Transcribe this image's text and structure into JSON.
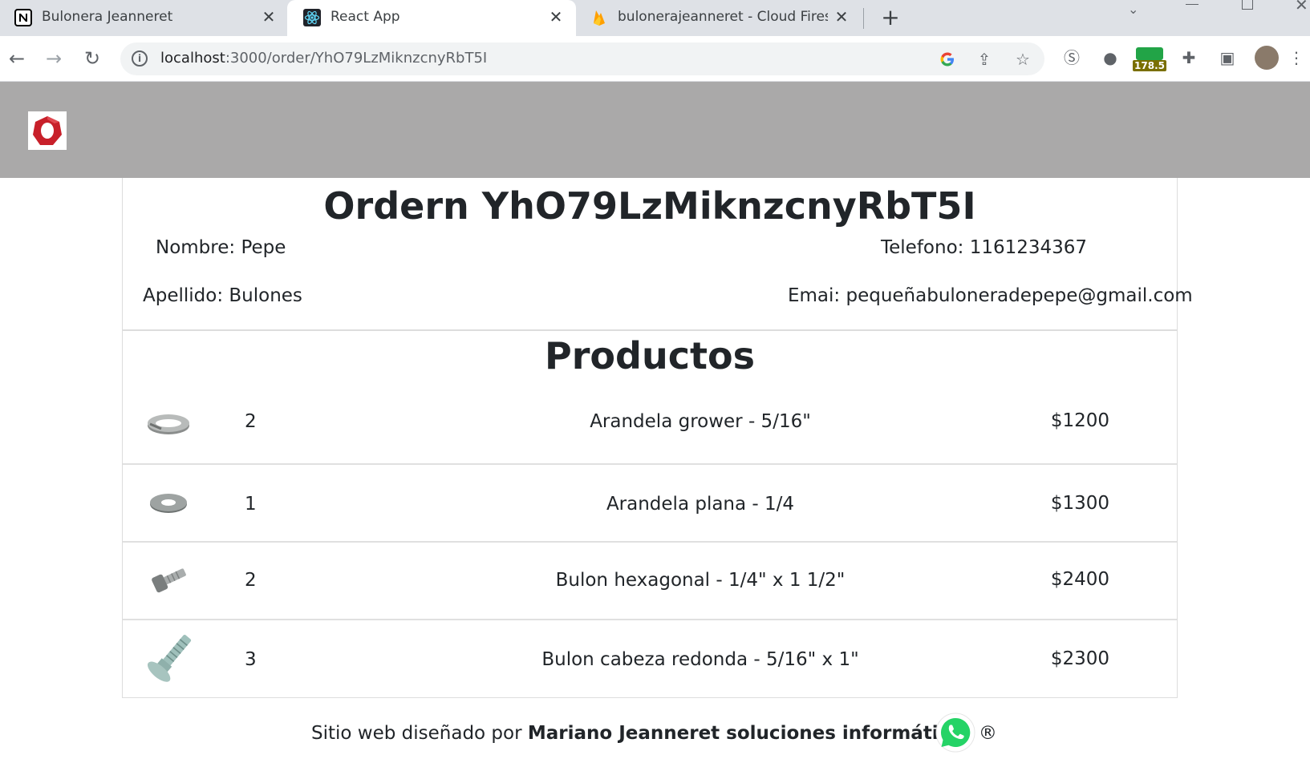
{
  "browser": {
    "tabs": [
      {
        "title": "Bulonera Jeanneret",
        "close": "✕"
      },
      {
        "title": "React App",
        "close": "✕"
      },
      {
        "title": "bulonerajeanneret - Cloud Firestore",
        "close": "✕"
      }
    ],
    "new_tab": "+",
    "url_host": "localhost",
    "url_rest": ":3000/order/YhO79LzMiknzcnyRbT5I",
    "extension_badge": "178.5"
  },
  "order": {
    "title": "Ordern YhO79LzMiknzcnyRbT5I",
    "nombre": "Nombre: Pepe",
    "apellido": "Apellido: Bulones",
    "telefono": "Telefono: 1161234367",
    "email": "Emai: pequeñabuloneradepepe@gmail.com"
  },
  "products": {
    "title": "Productos",
    "items": [
      {
        "qty": "2",
        "name": "Arandela grower - 5/16\"",
        "price": "$1200",
        "image": "lock-washer"
      },
      {
        "qty": "1",
        "name": "Arandela plana - 1/4",
        "price": "$1300",
        "image": "flat-washer"
      },
      {
        "qty": "2",
        "name": "Bulon hexagonal - 1/4\" x 1 1/2\"",
        "price": "$2400",
        "image": "hex-bolt"
      },
      {
        "qty": "3",
        "name": "Bulon cabeza redonda - 5/16\" x 1\"",
        "price": "$2300",
        "image": "carriage-bolt"
      }
    ]
  },
  "footer": {
    "prefix": "Sitio web diseñado por ",
    "author": "Mariano Jeanneret soluciones informáticas",
    "mark": " ®"
  },
  "colors": {
    "appbar": "#aaa9a9",
    "logo_red": "#c8202a",
    "whatsapp_green": "#25d366"
  }
}
